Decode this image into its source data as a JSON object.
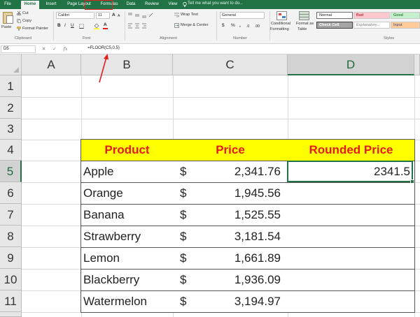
{
  "ribbon": {
    "tabs": [
      {
        "label": "File"
      },
      {
        "label": "Home",
        "active": true
      },
      {
        "label": "Insert"
      },
      {
        "label": "Page Layout"
      },
      {
        "label": "Formulas"
      },
      {
        "label": "Data"
      },
      {
        "label": "Review"
      },
      {
        "label": "View"
      }
    ],
    "tell_me": "Tell me what you want to do...",
    "clipboard": {
      "paste": "Paste",
      "cut": "Cut",
      "copy": "Copy",
      "format_painter": "Format Painter",
      "group": "Clipboard"
    },
    "font": {
      "name": "Calibri",
      "size": "11",
      "bold": "B",
      "italic": "I",
      "underline": "U",
      "group": "Font"
    },
    "alignment": {
      "wrap_text": "Wrap Text",
      "merge_center": "Merge & Center",
      "group": "Alignment"
    },
    "number": {
      "format": "General",
      "currency": "$",
      "percent": "%",
      "comma": ",",
      "group": "Number"
    },
    "styles": {
      "conditional_formatting": [
        "Conditional",
        "Formatting"
      ],
      "format_as_table": [
        "Format as",
        "Table"
      ],
      "cells": [
        {
          "label": "Normal"
        },
        {
          "label": "Bad"
        },
        {
          "label": "Good"
        },
        {
          "label": "Check Cell"
        },
        {
          "label": "Explanatory..."
        },
        {
          "label": "Input"
        }
      ],
      "group": "Styles"
    }
  },
  "formula_bar": {
    "name_box": "D5",
    "fx": "fx",
    "formula": "=FLOOR(C5,0.5)"
  },
  "columns": [
    "A",
    "B",
    "C",
    "D"
  ],
  "rows": [
    "1",
    "2",
    "3",
    "4",
    "5",
    "6",
    "7",
    "8",
    "9",
    "10",
    "11"
  ],
  "table": {
    "headers": [
      "Product",
      "Price",
      "Rounded Price"
    ],
    "currency": "$",
    "rows": [
      {
        "product": "Apple",
        "price": "2,341.76",
        "rounded": "2341.5"
      },
      {
        "product": "Orange",
        "price": "1,945.56",
        "rounded": ""
      },
      {
        "product": "Banana",
        "price": "1,525.55",
        "rounded": ""
      },
      {
        "product": "Strawberry",
        "price": "3,181.54",
        "rounded": ""
      },
      {
        "product": "Lemon",
        "price": "1,661.89",
        "rounded": ""
      },
      {
        "product": "Blackberry",
        "price": "1,936.09",
        "rounded": ""
      },
      {
        "product": "Watermelon",
        "price": "3,194.97",
        "rounded": ""
      }
    ]
  },
  "colors": {
    "excel_green": "#217346",
    "header_fill": "#ffff00",
    "header_text": "#e31b1b",
    "annotation": "#e02020"
  }
}
